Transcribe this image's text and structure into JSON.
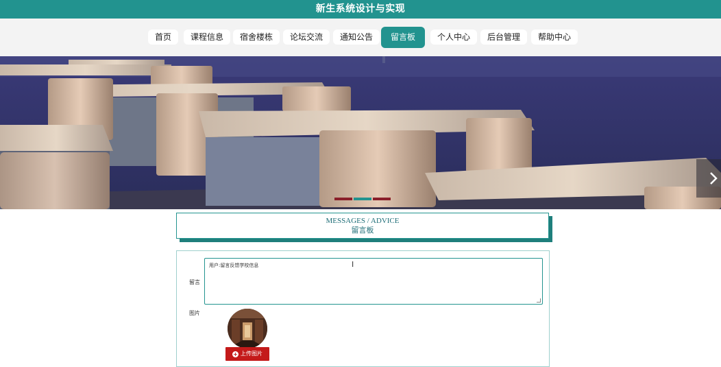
{
  "header": {
    "title": "新生系统设计与实现"
  },
  "nav": {
    "items": [
      {
        "label": "首页"
      },
      {
        "label": "课程信息"
      },
      {
        "label": "宿舍楼栋"
      },
      {
        "label": "论坛交流"
      },
      {
        "label": "通知公告"
      },
      {
        "label": "留言板",
        "active": true
      },
      {
        "label": "个人中心"
      },
      {
        "label": "后台管理"
      },
      {
        "label": "帮助中心"
      }
    ]
  },
  "section": {
    "title_en": "MESSAGES / ADVICE",
    "title_cn": "留言板"
  },
  "form": {
    "message_label": "留言",
    "message_value": "用户:留言反馈学校信息",
    "image_label": "图片",
    "upload_label": "上传图片"
  },
  "colors": {
    "accent": "#22938f",
    "upload": "#c41a1a"
  },
  "icons": {
    "next": "chevron-right-icon",
    "plus": "plus-circle-icon"
  }
}
